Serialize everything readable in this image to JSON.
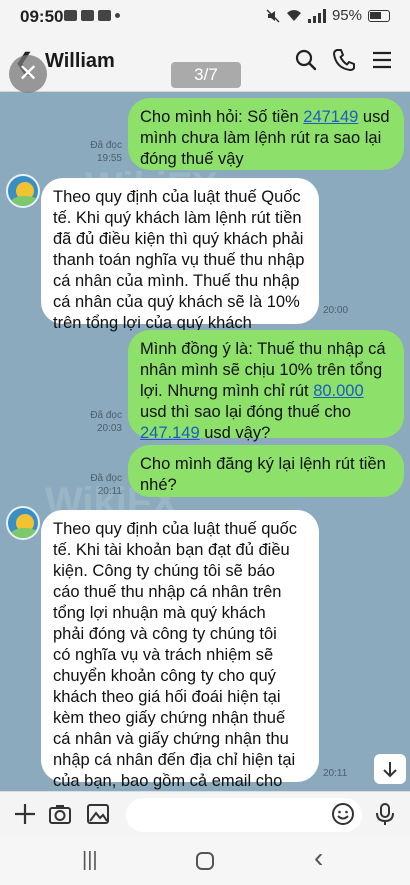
{
  "status_bar": {
    "time": "09:50",
    "battery": "95%"
  },
  "header": {
    "back_icon": "chevron-left-icon",
    "contact_name": "William",
    "counter": "3/7",
    "close": "✕"
  },
  "messages": [
    {
      "type": "sent",
      "text_before": "Cho mình hỏi: Số tiền ",
      "link": "247149",
      "text_after": " usd\nmình chưa làm lệnh rút ra sao lại\nđóng thuế vậy",
      "read": "Đã đọc",
      "time": "19:55"
    },
    {
      "type": "recv",
      "text": "Theo quy định của luật thuế Quốc\ntế. Khi quý khách làm lệnh rút tiền\nđã đủ điều kiện thì quý khách phải\nthanh toán nghĩa vụ thuế thu nhập\ncá nhân của mình. Thuế thu nhập\ncá nhân của quý khách sẽ là 10%\ntrên tổng lợi của quý khách",
      "time": "20:00"
    },
    {
      "type": "sent",
      "text_a": "Mình đồng ý là: Thuế thu nhập cá\nnhân mình sẽ chịu 10% trên tổng\nlợi. Nhưng mình chỉ rút ",
      "link_a": "80.000",
      "text_b": "\nusd thì sao lại đóng thuế cho\n",
      "link_b": "247.149",
      "text_c": " usd vậy?",
      "read": "Đã đọc",
      "time": "20:03"
    },
    {
      "type": "sent",
      "text": "Cho mình đăng ký lại lệnh rút tiền\nnhé?",
      "read": "Đã đọc",
      "time": "20:11"
    },
    {
      "type": "recv",
      "text": "Theo quy định của luật thuế quốc\ntế. Khi tài khoản bạn đạt đủ điều\nkiện. Công ty chúng tôi sẽ báo\ncáo thuế thu nhập cá nhân trên\ntổng lợi nhuận mà quý khách\nphải đóng và công ty chúng tôi\ncó nghĩa vụ và trách nhiệm sẽ\nchuyển khoản công ty cho quý\nkhách theo giá hối đoái hiện tại\nkèm theo giấy chứng nhận thuế\ncá nhân và giấy chứng nhận thu\nnhập cá nhân đến địa chỉ hiện tại\ncủa bạn, bao gồm cả email cho\nbạn.",
      "time": "20:11"
    }
  ],
  "watermark_text": "WikiFX",
  "input_bar": {
    "icons": [
      "plus-icon",
      "camera-icon",
      "image-icon",
      "emoji-icon",
      "microphone-icon"
    ]
  },
  "nav_bar": {
    "recents": "|||",
    "back": "‹"
  }
}
